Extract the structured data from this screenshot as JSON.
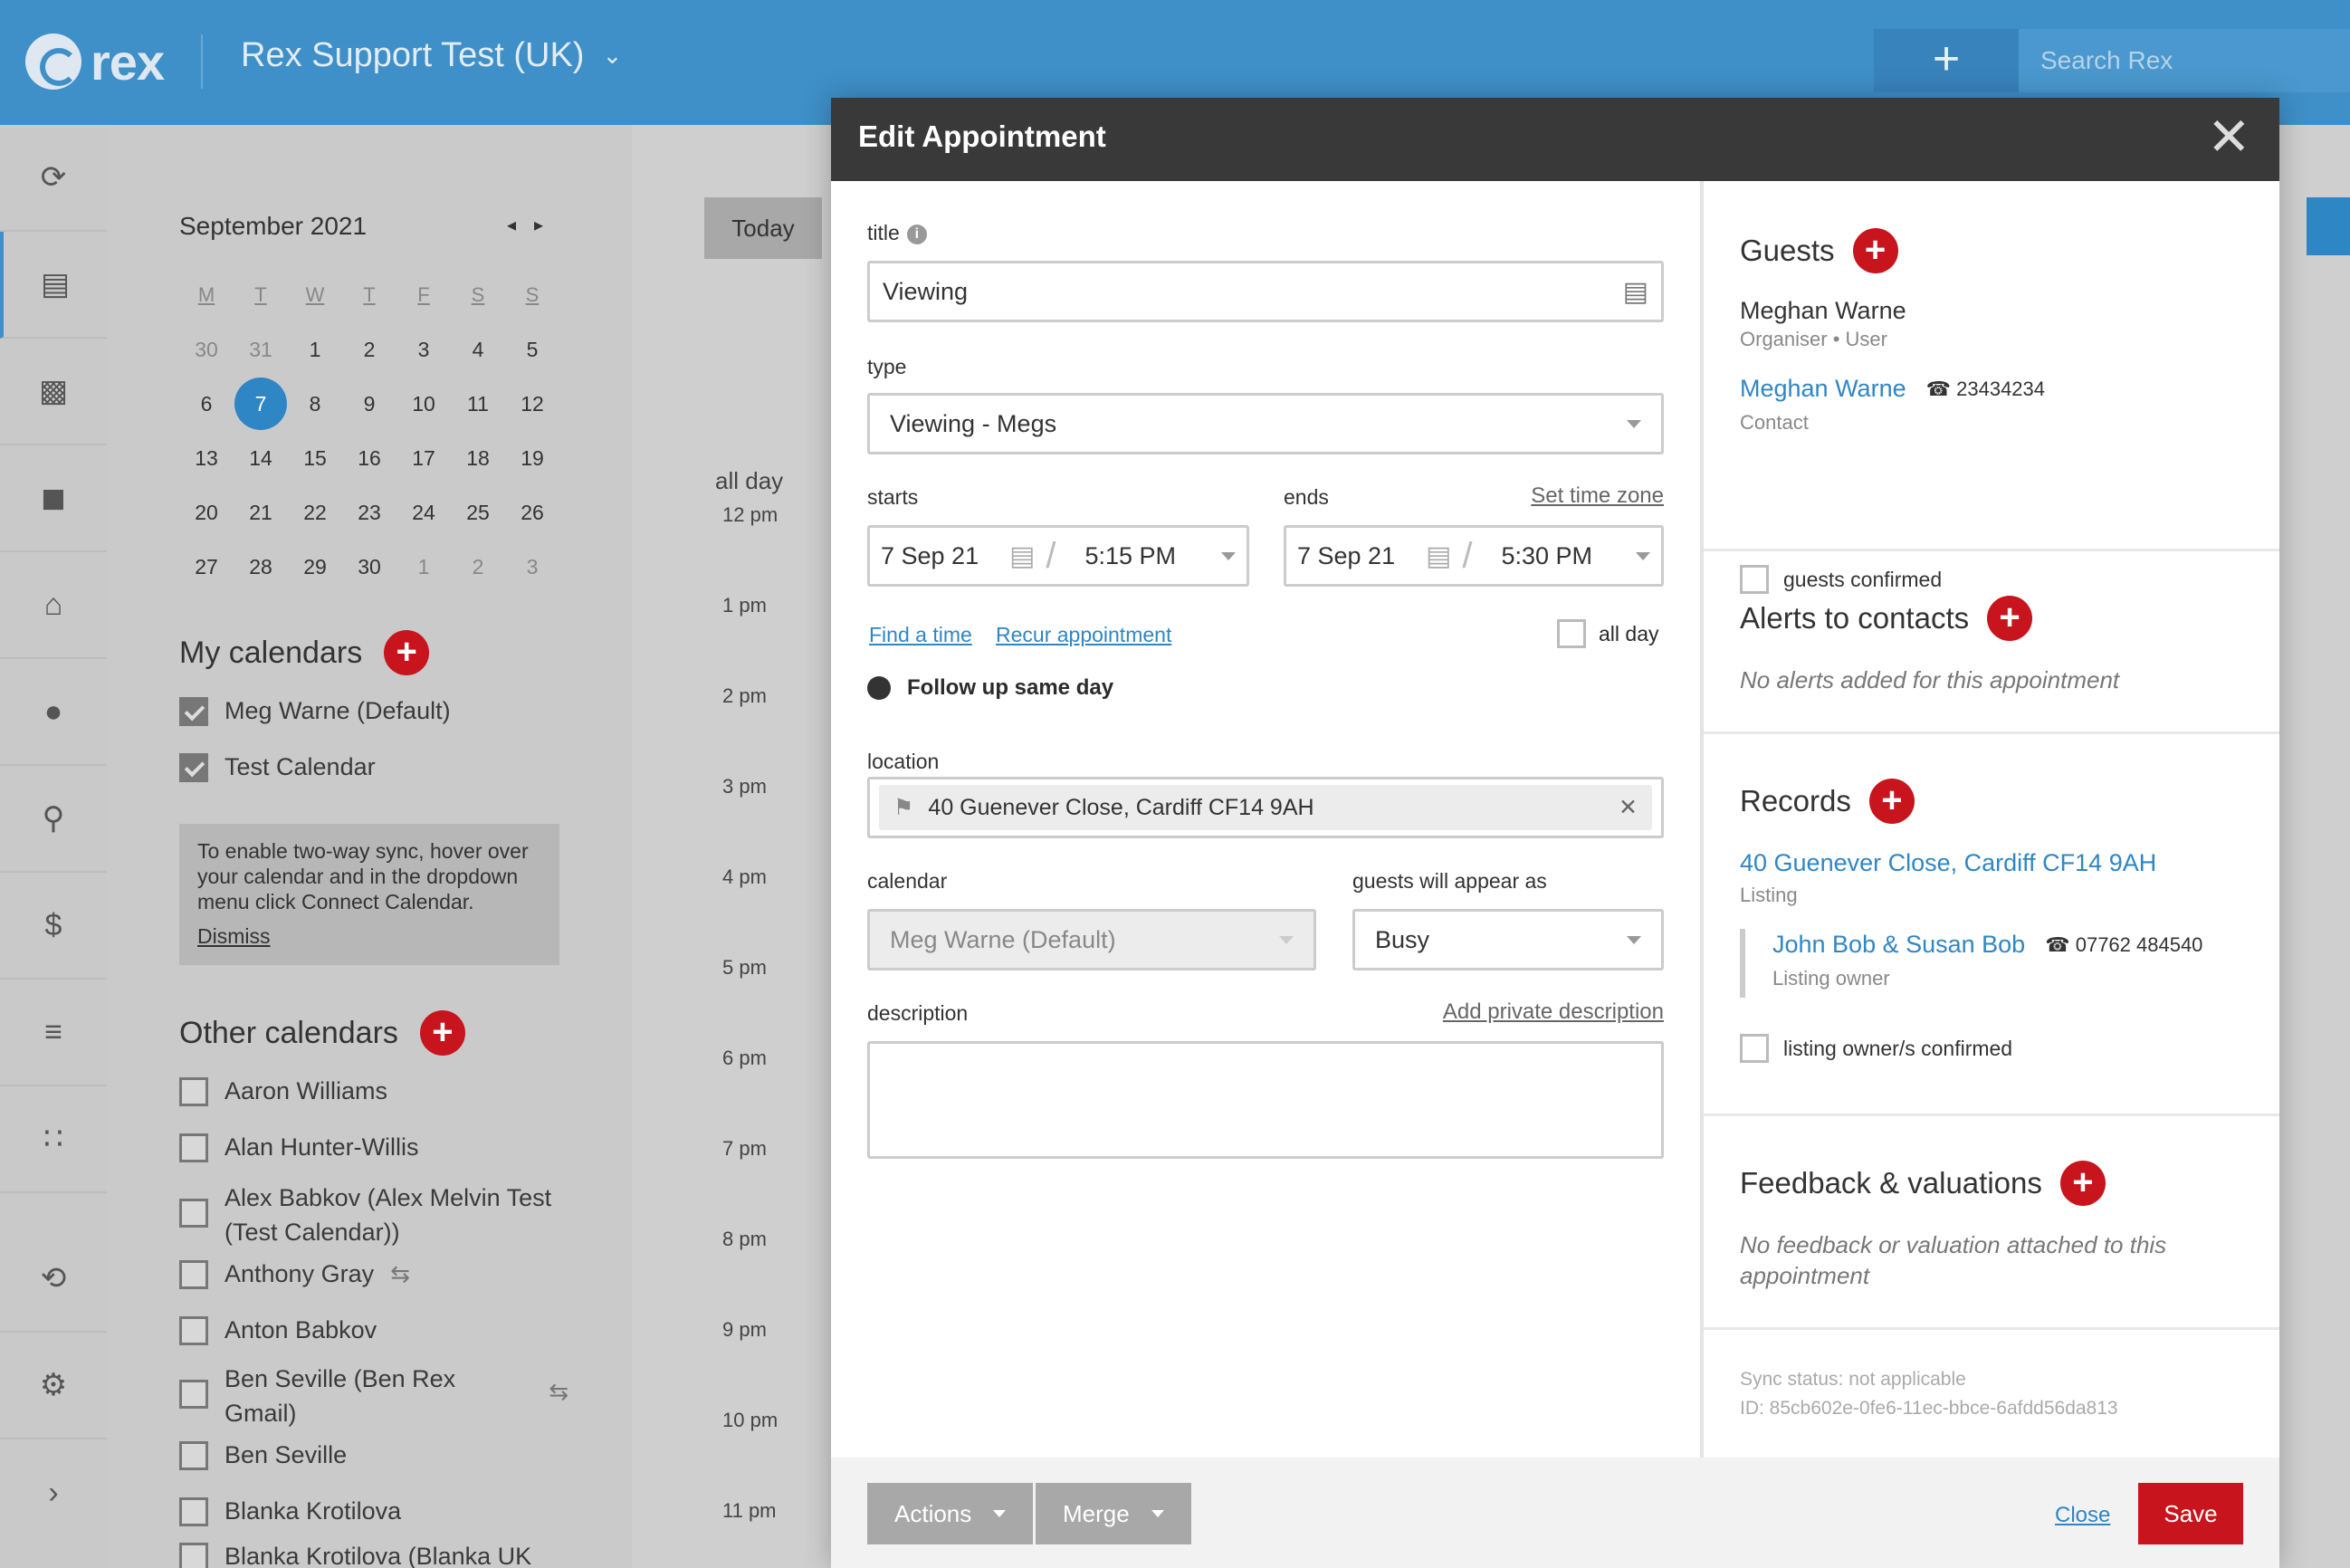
{
  "topbar": {
    "logo_text": "rex",
    "account": "Rex Support Test (UK)",
    "add_label": "+",
    "search_placeholder": "Search Rex"
  },
  "rail": {
    "icons": [
      "rex-home-icon",
      "calendar-icon",
      "chart-icon",
      "signpost-icon",
      "house-icon",
      "person-icon",
      "contact-card-icon",
      "dollar-icon",
      "feed-icon",
      "apps-grid-icon",
      "refresh-icon",
      "gear-icon",
      "expand-chevron-icon"
    ]
  },
  "mini_calendar": {
    "month": "September 2021",
    "weekdays": [
      "M",
      "T",
      "W",
      "T",
      "F",
      "S",
      "S"
    ],
    "weeks": [
      [
        "30",
        "31",
        "1",
        "2",
        "3",
        "4",
        "5"
      ],
      [
        "6",
        "7",
        "8",
        "9",
        "10",
        "11",
        "12"
      ],
      [
        "13",
        "14",
        "15",
        "16",
        "17",
        "18",
        "19"
      ],
      [
        "20",
        "21",
        "22",
        "23",
        "24",
        "25",
        "26"
      ],
      [
        "27",
        "28",
        "29",
        "30",
        "1",
        "2",
        "3"
      ]
    ]
  },
  "my_calendars": {
    "title": "My calendars",
    "items": [
      "Meg Warne (Default)",
      "Test Calendar"
    ]
  },
  "sync_note": {
    "text": "To enable two-way sync, hover over your calendar and in the dropdown menu click Connect Calendar.",
    "dismiss": "Dismiss"
  },
  "other_calendars": {
    "title": "Other calendars",
    "items": [
      "Aaron Williams",
      "Alan Hunter-Willis",
      "Alex Babkov (Alex Melvin Test (Test Calendar))",
      "Anthony Gray",
      "Anton Babkov",
      "Ben Seville (Ben Rex Gmail)",
      "Ben Seville",
      "Blanka Krotilova",
      "Blanka Krotilova (Blanka UK"
    ]
  },
  "main": {
    "today": "Today",
    "all_day": "all day",
    "hours": [
      "12 pm",
      "1 pm",
      "2 pm",
      "3 pm",
      "4 pm",
      "5 pm",
      "6 pm",
      "7 pm",
      "8 pm",
      "9 pm",
      "10 pm",
      "11 pm"
    ]
  },
  "modal": {
    "title": "Edit Appointment",
    "form": {
      "title_label": "title",
      "title_value": "Viewing",
      "type_label": "type",
      "type_value": "Viewing - Megs",
      "starts_label": "starts",
      "ends_label": "ends",
      "set_time_zone": "Set time zone",
      "start_date": "7 Sep 21",
      "start_time": "5:15 PM",
      "end_date": "7 Sep 21",
      "end_time": "5:30 PM",
      "find_a_time": "Find a time",
      "recur": "Recur appointment",
      "all_day": "all day",
      "follow_up": "Follow up same day",
      "location_label": "location",
      "location_value": "40 Guenever Close, Cardiff CF14 9AH",
      "calendar_label": "calendar",
      "calendar_value": "Meg Warne (Default)",
      "appear_label": "guests will appear as",
      "appear_value": "Busy",
      "description_label": "description",
      "add_private": "Add private description"
    },
    "guests": {
      "title": "Guests",
      "organiser_name": "Meghan Warne",
      "organiser_role": "Organiser • User",
      "contact_name": "Meghan Warne",
      "contact_phone": "23434234",
      "contact_role": "Contact",
      "confirmed": "guests confirmed"
    },
    "alerts": {
      "title": "Alerts to contacts",
      "empty": "No alerts added for this appointment"
    },
    "records": {
      "title": "Records",
      "listing": "40 Guenever Close, Cardiff CF14 9AH",
      "listing_type": "Listing",
      "owner": "John Bob & Susan Bob",
      "owner_phone": "07762 484540",
      "owner_role": "Listing owner",
      "confirmed": "listing owner/s confirmed"
    },
    "feedback": {
      "title": "Feedback & valuations",
      "empty": "No feedback or valuation attached to this appointment"
    },
    "sync": {
      "status": "Sync status: not applicable",
      "id": "ID: 85cb602e-0fe6-11ec-bbce-6afdd56da813"
    },
    "footer": {
      "actions": "Actions",
      "merge": "Merge",
      "close": "Close",
      "save": "Save"
    }
  },
  "colors": {
    "topbar": "#3f8fc8",
    "accent_red": "#c8141c",
    "link_blue": "#2f86c4",
    "modal_header": "#393939"
  }
}
